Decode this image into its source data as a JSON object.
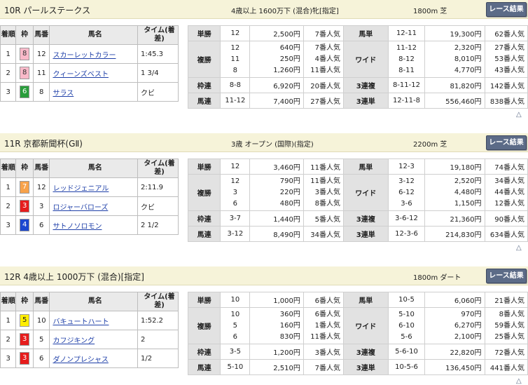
{
  "common": {
    "button_label": "レース結果",
    "result_headers": {
      "chaku": "着順",
      "waku": "枠",
      "uma": "馬番",
      "name": "馬名",
      "time": "タイム(着差)"
    },
    "pay_labels": {
      "tansho": "単勝",
      "fukusho": "複勝",
      "wakuren": "枠連",
      "umaren": "馬連",
      "umatan": "馬単",
      "wide": "ワイド",
      "sanrenpuku": "3連複",
      "sanrentan": "3連単"
    },
    "back_to_top": "△"
  },
  "colors": {
    "waku_8": "#f9b9c9",
    "waku_7": "#f7a24a",
    "waku_6": "#2a9d3c",
    "waku_5": "#ffee00",
    "waku_4": "#1b48d0",
    "waku_3": "#e61d1d"
  },
  "races": [
    {
      "title": "10R パールステークス",
      "condition": "4歳以上 1600万下 (混合)牝[指定]",
      "distance": "1800m 芝",
      "results": [
        {
          "chaku": "1",
          "waku": "8",
          "uma": "12",
          "name": "スカーレットカラー",
          "time": "1:45.3"
        },
        {
          "chaku": "2",
          "waku": "8",
          "uma": "11",
          "name": "クィーンズベスト",
          "time": "1 3/4"
        },
        {
          "chaku": "3",
          "waku": "6",
          "uma": "8",
          "name": "サラス",
          "time": "クビ"
        }
      ],
      "tansho": {
        "num": "12",
        "yen": "2,500円",
        "pop": "7番人気"
      },
      "fukusho": [
        {
          "num": "12",
          "yen": "640円",
          "pop": "7番人気"
        },
        {
          "num": "11",
          "yen": "250円",
          "pop": "4番人気"
        },
        {
          "num": "8",
          "yen": "1,260円",
          "pop": "11番人気"
        }
      ],
      "wakuren": {
        "num": "8-8",
        "yen": "6,920円",
        "pop": "20番人気"
      },
      "umaren": {
        "num": "11-12",
        "yen": "7,400円",
        "pop": "27番人気"
      },
      "umatan": {
        "num": "12-11",
        "yen": "19,300円",
        "pop": "62番人気"
      },
      "wide": [
        {
          "num": "11-12",
          "yen": "2,320円",
          "pop": "27番人気"
        },
        {
          "num": "8-12",
          "yen": "8,010円",
          "pop": "53番人気"
        },
        {
          "num": "8-11",
          "yen": "4,770円",
          "pop": "43番人気"
        }
      ],
      "sanrenpuku": {
        "num": "8-11-12",
        "yen": "81,820円",
        "pop": "142番人気"
      },
      "sanrentan": {
        "num": "12-11-8",
        "yen": "556,460円",
        "pop": "838番人気"
      }
    },
    {
      "title": "11R 京都新聞杯(GⅡ)",
      "condition": "3歳 オープン (国際)(指定)",
      "distance": "2200m 芝",
      "results": [
        {
          "chaku": "1",
          "waku": "7",
          "uma": "12",
          "name": "レッドジェニアル",
          "time": "2:11.9"
        },
        {
          "chaku": "2",
          "waku": "3",
          "uma": "3",
          "name": "ロジャーバローズ",
          "time": "クビ"
        },
        {
          "chaku": "3",
          "waku": "4",
          "uma": "6",
          "name": "サトノソロモン",
          "time": "2 1/2"
        }
      ],
      "tansho": {
        "num": "12",
        "yen": "3,460円",
        "pop": "11番人気"
      },
      "fukusho": [
        {
          "num": "12",
          "yen": "790円",
          "pop": "11番人気"
        },
        {
          "num": "3",
          "yen": "220円",
          "pop": "3番人気"
        },
        {
          "num": "6",
          "yen": "480円",
          "pop": "8番人気"
        }
      ],
      "wakuren": {
        "num": "3-7",
        "yen": "1,440円",
        "pop": "5番人気"
      },
      "umaren": {
        "num": "3-12",
        "yen": "8,490円",
        "pop": "34番人気"
      },
      "umatan": {
        "num": "12-3",
        "yen": "19,180円",
        "pop": "74番人気"
      },
      "wide": [
        {
          "num": "3-12",
          "yen": "2,520円",
          "pop": "34番人気"
        },
        {
          "num": "6-12",
          "yen": "4,480円",
          "pop": "44番人気"
        },
        {
          "num": "3-6",
          "yen": "1,150円",
          "pop": "12番人気"
        }
      ],
      "sanrenpuku": {
        "num": "3-6-12",
        "yen": "21,360円",
        "pop": "90番人気"
      },
      "sanrentan": {
        "num": "12-3-6",
        "yen": "214,830円",
        "pop": "634番人気"
      }
    },
    {
      "title": "12R 4歳以上 1000万下 (混合)[指定]",
      "condition": "",
      "distance": "1800m ダート",
      "results": [
        {
          "chaku": "1",
          "waku": "5",
          "uma": "10",
          "name": "バキュートハート",
          "time": "1:52.2"
        },
        {
          "chaku": "2",
          "waku": "3",
          "uma": "5",
          "name": "カフジキング",
          "time": "2"
        },
        {
          "chaku": "3",
          "waku": "3",
          "uma": "6",
          "name": "ダノンプレシャス",
          "time": "1/2"
        }
      ],
      "tansho": {
        "num": "10",
        "yen": "1,000円",
        "pop": "6番人気"
      },
      "fukusho": [
        {
          "num": "10",
          "yen": "360円",
          "pop": "6番人気"
        },
        {
          "num": "5",
          "yen": "160円",
          "pop": "1番人気"
        },
        {
          "num": "6",
          "yen": "830円",
          "pop": "11番人気"
        }
      ],
      "wakuren": {
        "num": "3-5",
        "yen": "1,200円",
        "pop": "3番人気"
      },
      "umaren": {
        "num": "5-10",
        "yen": "2,510円",
        "pop": "7番人気"
      },
      "umatan": {
        "num": "10-5",
        "yen": "6,060円",
        "pop": "21番人気"
      },
      "wide": [
        {
          "num": "5-10",
          "yen": "970円",
          "pop": "8番人気"
        },
        {
          "num": "6-10",
          "yen": "6,270円",
          "pop": "59番人気"
        },
        {
          "num": "5-6",
          "yen": "2,100円",
          "pop": "25番人気"
        }
      ],
      "sanrenpuku": {
        "num": "5-6-10",
        "yen": "22,820円",
        "pop": "72番人気"
      },
      "sanrentan": {
        "num": "10-5-6",
        "yen": "136,450円",
        "pop": "441番人気"
      }
    }
  ]
}
